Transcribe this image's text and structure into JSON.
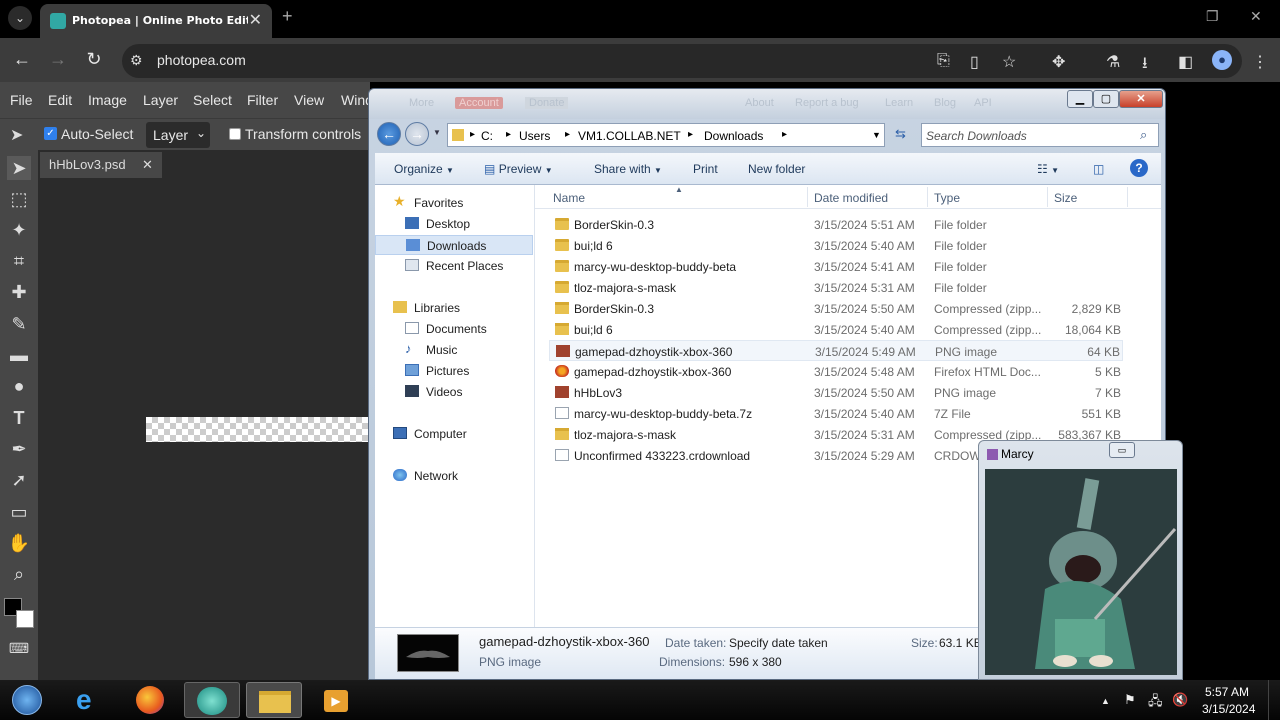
{
  "browser": {
    "tab_title": "Photopea | Online Photo Editor",
    "tab_close": "✕",
    "new_tab": "+",
    "url": "photopea.com",
    "back": "←",
    "forward": "→",
    "reload": "↻"
  },
  "photopea": {
    "menu": [
      "File",
      "Edit",
      "Image",
      "Layer",
      "Select",
      "Filter",
      "View",
      "Window"
    ],
    "options": {
      "auto_select_label": "Auto-Select",
      "auto_select_checked": true,
      "layer_select_value": "Layer",
      "transform_controls_label": "Transform controls"
    },
    "doc_tab": "hHbLov3.psd",
    "doc_tab_close": "✕",
    "behind_menu": [
      "More",
      "Account",
      "Donate",
      "About",
      "Report a bug",
      "Learn",
      "Blog",
      "API"
    ]
  },
  "explorer": {
    "address": [
      "C:",
      "Users",
      "VM1.COLLAB.NET",
      "Downloads"
    ],
    "search_placeholder": "Search Downloads",
    "commands": [
      "Organize",
      "Preview",
      "Share with",
      "Print",
      "New folder"
    ],
    "nav": {
      "favorites_header": "Favorites",
      "favorites": [
        "Desktop",
        "Downloads",
        "Recent Places"
      ],
      "libraries_header": "Libraries",
      "libraries": [
        "Documents",
        "Music",
        "Pictures",
        "Videos"
      ],
      "computer": "Computer",
      "network": "Network",
      "selected": "Downloads"
    },
    "columns": [
      "Name",
      "Date modified",
      "Type",
      "Size"
    ],
    "files": [
      {
        "name": "BorderSkin-0.3",
        "date": "3/15/2024 5:51 AM",
        "type": "File folder",
        "size": "",
        "icon": "folder"
      },
      {
        "name": "bui;ld 6",
        "date": "3/15/2024 5:40 AM",
        "type": "File folder",
        "size": "",
        "icon": "folder"
      },
      {
        "name": "marcy-wu-desktop-buddy-beta",
        "date": "3/15/2024 5:41 AM",
        "type": "File folder",
        "size": "",
        "icon": "folder"
      },
      {
        "name": "tloz-majora-s-mask",
        "date": "3/15/2024 5:31 AM",
        "type": "File folder",
        "size": "",
        "icon": "folder"
      },
      {
        "name": "BorderSkin-0.3",
        "date": "3/15/2024 5:50 AM",
        "type": "Compressed (zipp...",
        "size": "2,829 KB",
        "icon": "zip"
      },
      {
        "name": "bui;ld 6",
        "date": "3/15/2024 5:40 AM",
        "type": "Compressed (zipp...",
        "size": "18,064 KB",
        "icon": "zip"
      },
      {
        "name": "gamepad-dzhoystik-xbox-360",
        "date": "3/15/2024 5:49 AM",
        "type": "PNG image",
        "size": "64 KB",
        "icon": "png"
      },
      {
        "name": "gamepad-dzhoystik-xbox-360",
        "date": "3/15/2024 5:48 AM",
        "type": "Firefox HTML Doc...",
        "size": "5 KB",
        "icon": "ff"
      },
      {
        "name": "hHbLov3",
        "date": "3/15/2024 5:50 AM",
        "type": "PNG image",
        "size": "7 KB",
        "icon": "png"
      },
      {
        "name": "marcy-wu-desktop-buddy-beta.7z",
        "date": "3/15/2024 5:40 AM",
        "type": "7Z File",
        "size": "551 KB",
        "icon": "file"
      },
      {
        "name": "tloz-majora-s-mask",
        "date": "3/15/2024 5:31 AM",
        "type": "Compressed (zipp...",
        "size": "583,367 KB",
        "icon": "zip"
      },
      {
        "name": "Unconfirmed 433223.crdownload",
        "date": "3/15/2024 5:29 AM",
        "type": "CRDOWNLOAD File",
        "size": "",
        "icon": "file"
      }
    ],
    "hovered_index": 6,
    "details": {
      "name": "gamepad-dzhoystik-xbox-360",
      "type": "PNG image",
      "date_taken_label": "Date taken:",
      "date_taken_value": "Specify date taken",
      "dimensions_label": "Dimensions:",
      "dimensions_value": "596 x 380",
      "size_label": "Size:",
      "size_value": "63.1 KB"
    }
  },
  "marcy": {
    "title": "Marcy"
  },
  "taskbar": {
    "time": "5:57 AM",
    "date": "3/15/2024"
  }
}
